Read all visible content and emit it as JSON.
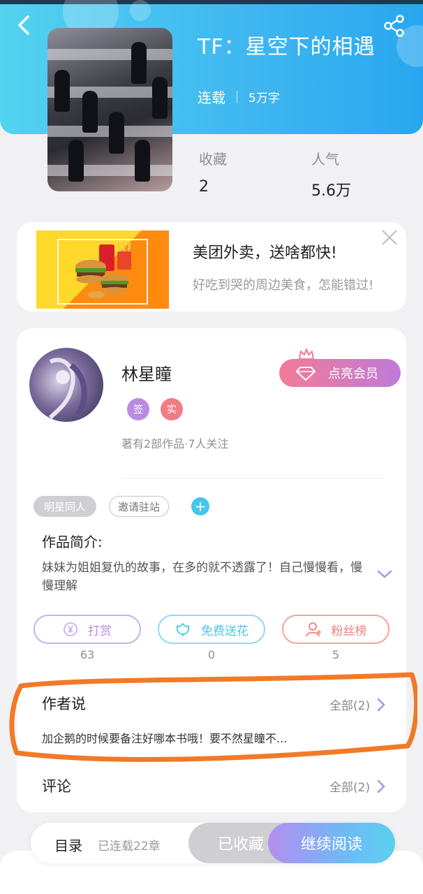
{
  "header": {
    "title": "TF：星空下的相遇",
    "status": "连载",
    "word_count": "5万字",
    "back_icon": "back-arrow-icon",
    "share_icon": "share-icon"
  },
  "stats": {
    "favorites_label": "收藏",
    "favorites_value": "2",
    "popularity_label": "人气",
    "popularity_value": "5.6万"
  },
  "ad": {
    "title": "美团外卖，送啥都快!",
    "subtitle": "好吃到哭的周边美食，怎能错过!"
  },
  "author": {
    "name": "林星瞳",
    "badges": [
      "签",
      "实"
    ],
    "badge_colors": [
      "#b98ce2",
      "#f07c86"
    ],
    "works_info": "著有2部作品·7人关注",
    "vip_label": "点亮会员"
  },
  "tags": {
    "genre": "明星同人",
    "invite": "邀请驻站",
    "add_icon": "plus-icon"
  },
  "intro": {
    "label": "作品简介:",
    "text": "妹妹为姐姐复仇的故事，在多的就不透露了！自己慢慢看，慢慢理解"
  },
  "actions": [
    {
      "label": "打赏",
      "count": "63",
      "icon": "yuan-coin-icon"
    },
    {
      "label": "免费送花",
      "count": "0",
      "icon": "flower-icon"
    },
    {
      "label": "粉丝榜",
      "count": "5",
      "icon": "fans-user-icon"
    }
  ],
  "author_says": {
    "title": "作者说",
    "more": "全部(2)",
    "content": "加企鹅的时候要备注好哪本书哦！要不然星瞳不..."
  },
  "comments": {
    "title": "评论",
    "more": "全部(2)"
  },
  "bottom_bar": {
    "toc_label": "目录",
    "toc_progress": "已连载22章",
    "collected_label": "已收藏",
    "continue_label": "继续阅读"
  },
  "colors": {
    "header_gradient_start": "#52d3ef",
    "header_gradient_end": "#28a7f0",
    "highlight_stroke": "#f07a28"
  }
}
